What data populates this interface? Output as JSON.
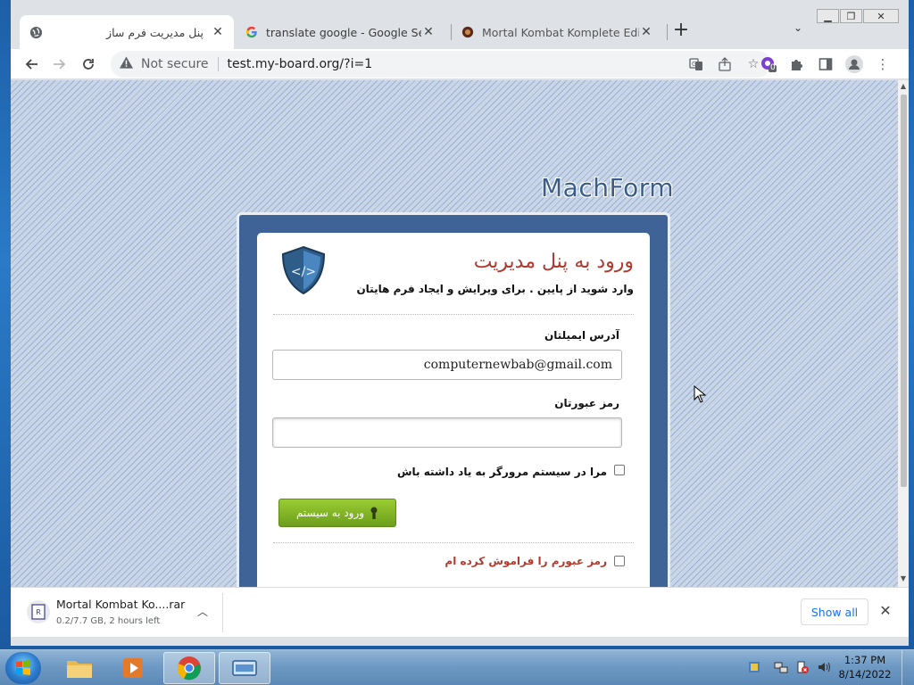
{
  "browser": {
    "tabs": [
      {
        "title": "پنل مدیریت فرم ساز",
        "icon": "globe-icon",
        "active": true
      },
      {
        "title": "translate google - Google Search",
        "icon": "google-icon",
        "active": false
      },
      {
        "title": "Mortal Kombat Komplete Edition",
        "icon": "site-favicon-icon",
        "active": false
      }
    ],
    "new_tab": "+",
    "security_label": "Not secure",
    "url": "test.my-board.org/?i=1",
    "extension_badge": "0"
  },
  "page": {
    "logo": "MachForm",
    "heading": "ورود به پنل مدیریت",
    "subheading": "وارد شوید از پایین . برای ویرایش و ایجاد فرم هایتان",
    "email_label": "آدرس ایمیلتان",
    "email_value": "computernewbab@gmail.com",
    "password_label": "رمز عبورتان",
    "password_value": "",
    "remember_label": "مرا در سیستم مرورگر به یاد داشته باش",
    "login_button": "ورود به سیستم",
    "forgot_label": "رمز عبورم را فراموش کرده ام"
  },
  "download": {
    "name": "Mortal Kombat Ko....rar",
    "status": "0.2/7.7 GB, 2 hours left",
    "show_all": "Show all"
  },
  "taskbar": {
    "time": "1:37 PM",
    "date": "8/14/2022"
  },
  "colors": {
    "heading": "#b03a2e",
    "frame": "#3f6396",
    "button": "#8bc22b",
    "link_accent": "#1a73e8"
  }
}
